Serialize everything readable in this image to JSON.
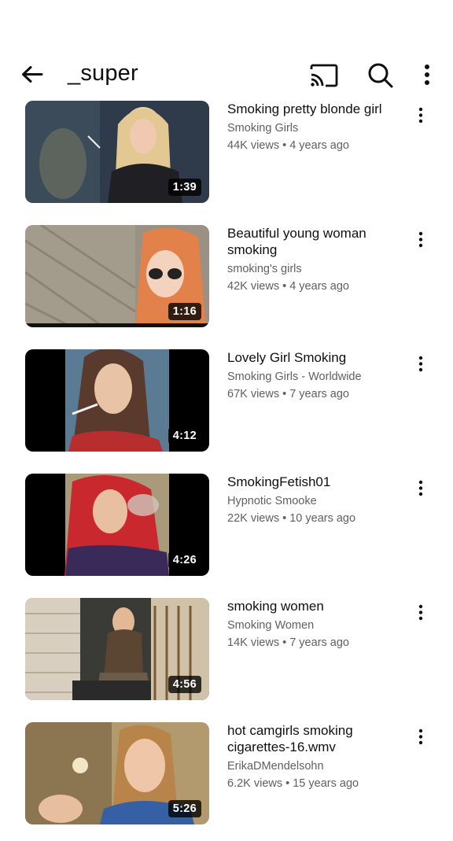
{
  "header": {
    "title": "_super",
    "icons": [
      "back-arrow-icon",
      "cast-icon",
      "search-icon",
      "more-vert-icon"
    ]
  },
  "colors": {
    "text_primary": "#0f0f0f",
    "text_secondary": "#606060",
    "duration_bg": "#000000"
  },
  "videos": [
    {
      "title": "Smoking pretty blonde girl",
      "channel": "Smoking Girls",
      "stats": "44K views • 4 years ago",
      "duration": "1:39"
    },
    {
      "title": "Beautiful young woman smoking",
      "channel": "smoking's girls",
      "stats": "42K views • 4 years ago",
      "duration": "1:16"
    },
    {
      "title": "Lovely Girl Smoking",
      "channel": "Smoking Girls - Worldwide",
      "stats": "67K views • 7 years ago",
      "duration": "4:12"
    },
    {
      "title": "SmokingFetish01",
      "channel": "Hypnotic Smooke",
      "stats": "22K views • 10 years ago",
      "duration": "4:26"
    },
    {
      "title": "smoking women",
      "channel": "Smoking Women",
      "stats": "14K views • 7 years ago",
      "duration": "4:56"
    },
    {
      "title": "hot camgirls smoking cigarettes-16.wmv",
      "channel": "ErikaDMendelsohn",
      "stats": "6.2K views • 15 years ago",
      "duration": "5:26"
    }
  ]
}
